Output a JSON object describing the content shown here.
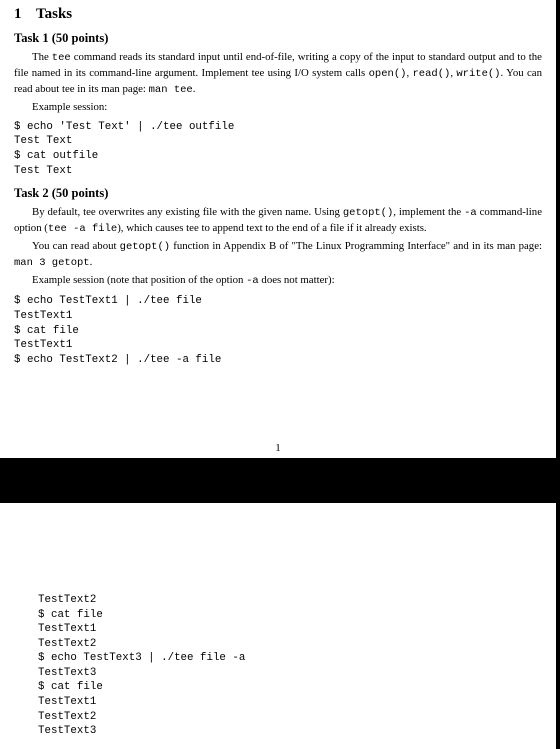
{
  "section": {
    "number": "1",
    "title": "Tasks"
  },
  "task1": {
    "heading": "Task 1 (50 points)",
    "para1_a": "The ",
    "para1_code1": "tee",
    "para1_b": " command reads its standard input until end-of-file, writing a copy of the input to standard output and to the file named in its command-line argument. Implement tee using I/O system calls ",
    "para1_code2": "open()",
    "para1_c": ", ",
    "para1_code3": "read()",
    "para1_d": ", ",
    "para1_code4": "write()",
    "para1_e": ". You can read about tee in its man page: ",
    "para1_code5": "man tee",
    "para1_f": ".",
    "para2": "Example session:",
    "session": "$ echo 'Test Text' | ./tee outfile\nTest Text\n$ cat outfile\nTest Text"
  },
  "task2": {
    "heading": "Task 2 (50 points)",
    "para1_a": "By default, tee overwrites any existing file with the given name.  Using ",
    "para1_code1": "getopt()",
    "para1_b": ", implement the ",
    "para1_code2": "-a",
    "para1_c": " command-line option (",
    "para1_code3": "tee -a file",
    "para1_d": "), which causes tee to append text to the end of a file if it already exists.",
    "para2_a": "You can read about ",
    "para2_code1": "getopt()",
    "para2_b": " function in Appendix B of \"The Linux Programming Interface\" and in its man page: ",
    "para2_code2": "man 3 getopt",
    "para2_c": ".",
    "para3_a": "Example session (note that position of the option ",
    "para3_code1": "-a",
    "para3_b": " does not matter):",
    "session_p1": "$ echo TestText1 | ./tee file\nTestText1\n$ cat file\nTestText1\n$ echo TestText2 | ./tee -a file",
    "session_p2": "TestText2\n$ cat file\nTestText1\nTestText2\n$ echo TestText3 | ./tee file -a\nTestText3\n$ cat file\nTestText1\nTestText2\nTestText3"
  },
  "page_number": "1"
}
